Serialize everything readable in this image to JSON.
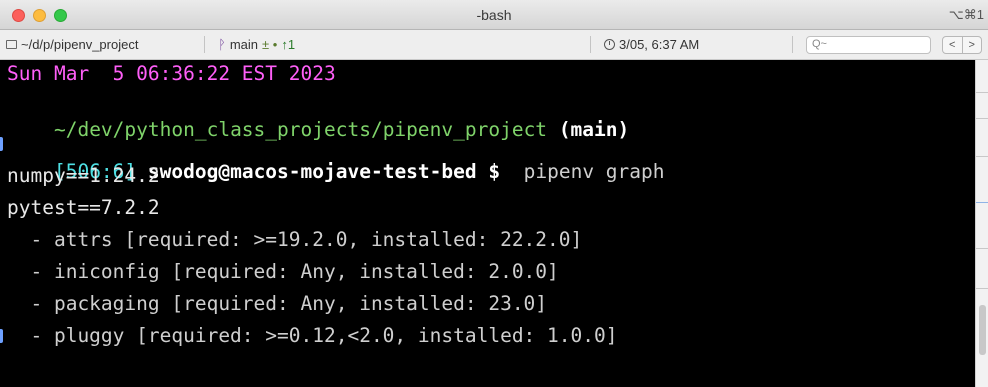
{
  "window": {
    "title": "-bash",
    "shortcut": "⌥⌘1"
  },
  "statusbar": {
    "path": "~/d/p/pipenv_project",
    "branch_icon": "ᚹ",
    "branch": "main",
    "git_status": "± •",
    "ahead": "↑1",
    "datetime": "3/05, 6:37 AM",
    "search_placeholder": "Q~",
    "nav_back": "<",
    "nav_forward": ">"
  },
  "terminal": {
    "date_line": "Sun Mar  5 06:36:22 EST 2023",
    "cwd": "~/dev/python_class_projects/pipenv_project",
    "branch_tag": "(main)",
    "prompt_counter": "[506:6]",
    "prompt_user_host": "swodog@macos-mojave-test-bed",
    "prompt_symbol": "$",
    "command": "pipenv graph",
    "output": [
      "numpy==1.24.2",
      "pytest==7.2.2",
      "  - attrs [required: >=19.2.0, installed: 22.2.0]",
      "  - iniconfig [required: Any, installed: 2.0.0]",
      "  - packaging [required: Any, installed: 23.0]",
      "  - pluggy [required: >=0.12,<2.0, installed: 1.0.0]"
    ]
  },
  "colors": {
    "date": "#ff5ff8",
    "cwd": "#7fd36a",
    "prompt_counter": "#4ee0e4",
    "background": "#000000"
  }
}
